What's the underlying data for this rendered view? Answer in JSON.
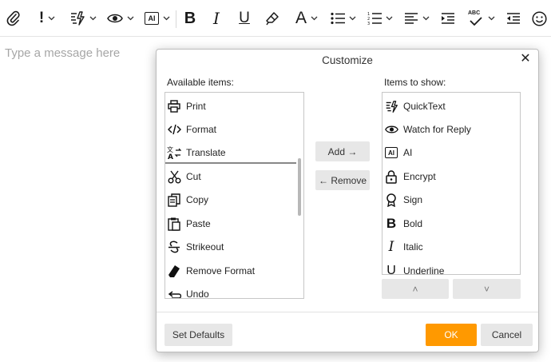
{
  "toolbar": {
    "icons": [
      "attachment-icon",
      "priority-icon",
      "quicktext-icon",
      "watch-for-reply-icon",
      "ai-icon",
      "bold-icon",
      "italic-icon",
      "underline-icon",
      "remove-format-icon",
      "font-icon",
      "bullet-list-icon",
      "numbered-list-icon",
      "align-icon",
      "indent-icon",
      "spellcheck-icon",
      "outdent-icon",
      "emoji-icon"
    ],
    "bold_glyph": "B",
    "italic_glyph": "I",
    "underline_glyph": "U",
    "font_glyph": "A",
    "ai_glyph": "AI",
    "spell_glyph": "ABC"
  },
  "compose": {
    "placeholder": "Type a message here"
  },
  "dialog": {
    "title": "Customize",
    "close_glyph": "✕",
    "available_label": "Available items:",
    "show_label": "Items to show:",
    "available_items": [
      {
        "label": "Print",
        "icon": "print-icon"
      },
      {
        "label": "Format",
        "icon": "code-icon"
      },
      {
        "label": "Translate",
        "icon": "translate-icon"
      },
      {
        "label": "Cut",
        "icon": "scissors-icon"
      },
      {
        "label": "Copy",
        "icon": "copy-icon"
      },
      {
        "label": "Paste",
        "icon": "paste-icon"
      },
      {
        "label": "Strikeout",
        "icon": "strikeout-icon"
      },
      {
        "label": "Remove Format",
        "icon": "eraser-icon"
      },
      {
        "label": "Undo",
        "icon": "undo-icon"
      }
    ],
    "show_items": [
      {
        "label": "QuickText",
        "icon": "quicktext-icon"
      },
      {
        "label": "Watch for Reply",
        "icon": "eye-icon"
      },
      {
        "label": "AI",
        "icon": "ai-icon"
      },
      {
        "label": "Encrypt",
        "icon": "lock-icon"
      },
      {
        "label": "Sign",
        "icon": "badge-icon"
      },
      {
        "label": "Bold",
        "icon": "bold-icon"
      },
      {
        "label": "Italic",
        "icon": "italic-icon"
      },
      {
        "label": "Underline",
        "icon": "underline-icon"
      }
    ],
    "add_label": "Add →",
    "remove_label": "← Remove",
    "up_glyph": "˄",
    "down_glyph": "˅",
    "set_defaults_label": "Set Defaults",
    "ok_label": "OK",
    "cancel_label": "Cancel",
    "ok_color": "#ff9900"
  }
}
